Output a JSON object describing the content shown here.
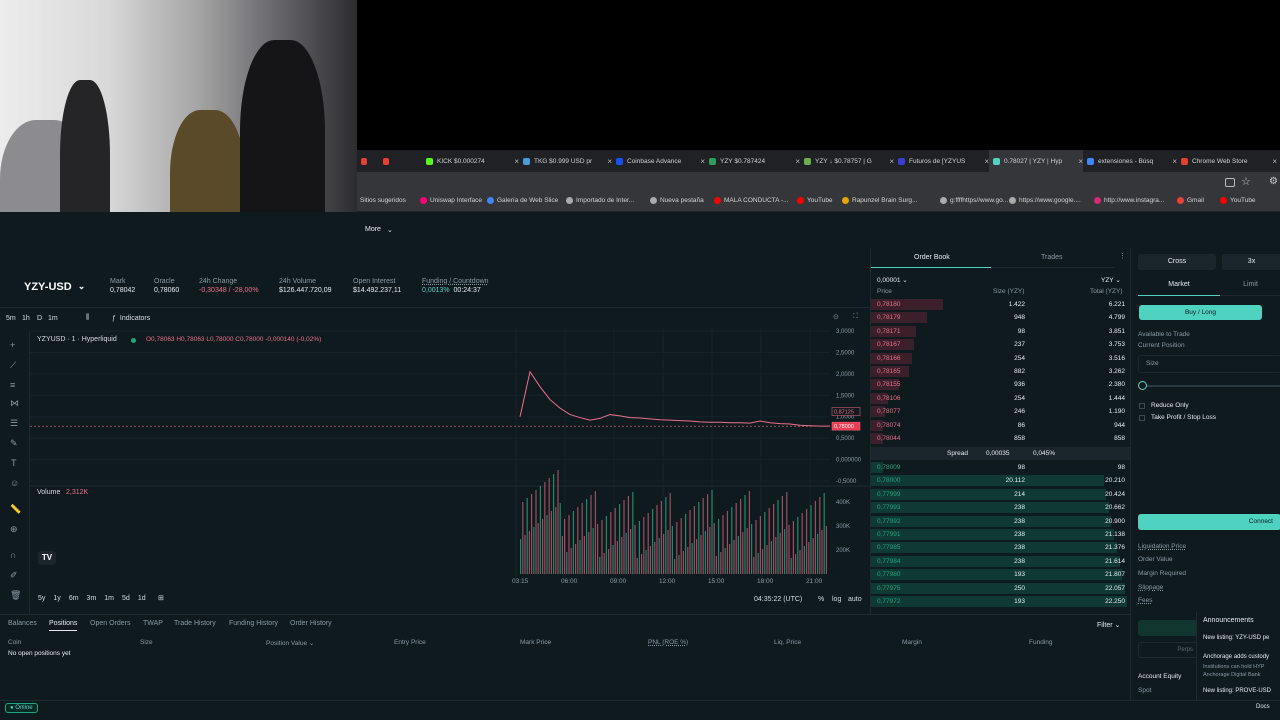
{
  "browser": {
    "tabs": [
      {
        "label": "KICK $0.000274",
        "color": "#53fc18"
      },
      {
        "label": "TKG $0.999 USD pr",
        "color": "#4a9bd6"
      },
      {
        "label": "Coinbase Advance",
        "color": "#1652f0"
      },
      {
        "label": "YZY $0.787424",
        "color": "#2b9e5a"
      },
      {
        "label": "YZY ↓ $0.78757 | G",
        "color": "#6ab04c"
      },
      {
        "label": "Futuros de [YZYUS",
        "color": "#3b3bd6"
      },
      {
        "label": "0.78027 | YZY | Hyp",
        "color": "#50d2c1"
      },
      {
        "label": "extensiones - Búsq",
        "color": "#4285f4"
      },
      {
        "label": "Chrome Web Store",
        "color": "#e34133"
      }
    ],
    "bookmarks": [
      "Sitios sugeridos",
      "Uniswap Interface",
      "Galería de Web Slice",
      "Importado de Inter...",
      "Nueva pestaña",
      "MALA CONDUCTA -...",
      "YouTube",
      "Rapunzel Brain Surg...",
      "g:ffffhttps//www.go...",
      "https://www.google....",
      "http://www.instagra...",
      "Gmail",
      "YouTube"
    ]
  },
  "nav": {
    "more_label": "More"
  },
  "market": {
    "symbol": "YZY-USD",
    "stats": [
      {
        "label": "Mark",
        "value": "0,78042"
      },
      {
        "label": "Oracle",
        "value": "0,78060"
      },
      {
        "label": "24h Change",
        "value": "-0,30348 / -28,00%"
      },
      {
        "label": "24h Volume",
        "value": "$126.447.720,09"
      },
      {
        "label": "Open Interest",
        "value": "$14.492.237,11"
      },
      {
        "label": "Funding / Countdown",
        "value": "0,0013%",
        "value2": "00:24:37"
      }
    ]
  },
  "chart_toolbar": {
    "interval": "5m",
    "items": [
      "1h",
      "D",
      "1m"
    ],
    "indicators": "Indicators"
  },
  "chart_legend": {
    "title": "YZYUSD · 1 · Hyperliquid",
    "ohlc": "O0,78063 H0,78063 L0,78000 C0,78000 -0,000140 (-0,02%)",
    "volume_label": "Volume",
    "volume_value": "2,312K"
  },
  "chart_data": {
    "type": "line",
    "x_ticks": [
      "03:15",
      "06:00",
      "09:00",
      "12:00",
      "15:00",
      "18:00",
      "21:00"
    ],
    "y_ticks": [
      "3,0000",
      "2,5000",
      "2,0000",
      "1,5000",
      "1,0000",
      "0,5000",
      "0,000000",
      "-0,5000"
    ],
    "price_labels": [
      "0,87125",
      "0,78000"
    ],
    "volume_ticks": [
      "400K",
      "300K",
      "200K"
    ],
    "series": [
      {
        "values": [
          1.0,
          2.05,
          1.7,
          1.4,
          1.2,
          1.05,
          0.98,
          0.92,
          0.96,
          1.05,
          1.02,
          0.98,
          0.97,
          0.95,
          0.93,
          0.92,
          0.91,
          0.9,
          0.88,
          0.87,
          0.87,
          0.86,
          0.86,
          0.85,
          0.9,
          0.86,
          0.84,
          0.83,
          0.8,
          0.79,
          0.78,
          0.78
        ]
      }
    ]
  },
  "chart_bottom": {
    "ranges": [
      "5y",
      "1y",
      "6m",
      "3m",
      "1m",
      "5d",
      "1d"
    ],
    "time": "04:35:22 (UTC)",
    "pct": "%",
    "log": "log",
    "auto": "auto"
  },
  "orderbook": {
    "tab_book": "Order Book",
    "tab_trades": "Trades",
    "tick": "0,00001",
    "unit": "YZY",
    "headers": [
      "Price",
      "Size (YZY)",
      "Total (YZY)"
    ],
    "asks": [
      [
        "0,78180",
        "1.422",
        "6.221"
      ],
      [
        "0,78179",
        "948",
        "4.799"
      ],
      [
        "0,78171",
        "98",
        "3.851"
      ],
      [
        "0,78167",
        "237",
        "3.753"
      ],
      [
        "0,78166",
        "254",
        "3.516"
      ],
      [
        "0,78165",
        "882",
        "3.262"
      ],
      [
        "0,78155",
        "936",
        "2.380"
      ],
      [
        "0,78106",
        "254",
        "1.444"
      ],
      [
        "0,78077",
        "246",
        "1.190"
      ],
      [
        "0,78074",
        "86",
        "944"
      ],
      [
        "0,78044",
        "858",
        "858"
      ]
    ],
    "spread_label": "Spread",
    "spread_value": "0,00035",
    "spread_pct": "0,045%",
    "bids": [
      [
        "0,78009",
        "98",
        "98"
      ],
      [
        "0,78000",
        "20.112",
        "20.210"
      ],
      [
        "0,77999",
        "214",
        "20.424"
      ],
      [
        "0,77993",
        "238",
        "20.662"
      ],
      [
        "0,77992",
        "238",
        "20.900"
      ],
      [
        "0,77991",
        "238",
        "21.138"
      ],
      [
        "0,77985",
        "238",
        "21.376"
      ],
      [
        "0,77984",
        "238",
        "21.614"
      ],
      [
        "0,77980",
        "193",
        "21.807"
      ],
      [
        "0,77975",
        "250",
        "22.057"
      ],
      [
        "0,77972",
        "193",
        "22.250"
      ]
    ]
  },
  "trade_panel": {
    "margin_mode": "Cross",
    "leverage": "3x",
    "tab_market": "Market",
    "tab_limit": "Limit",
    "side": "Buy / Long",
    "available": "Available to Trade",
    "current_position": "Current Position",
    "size": "Size",
    "reduce_only": "Reduce Only",
    "tpsl": "Take Profit / Stop Loss",
    "connect": "Connect",
    "details": [
      "Liquidation Price",
      "Order Value",
      "Margin Required",
      "Slippage",
      "Fees"
    ],
    "perps": "Perps",
    "account_equity": "Account Equity",
    "spot": "Spot"
  },
  "announcements": {
    "title": "Announcements",
    "items": [
      "New listing: YZY-USD pe",
      "Anchorage adds custody",
      "Institutions can hold HYP",
      "Anchorage Digital Bank",
      "New listing: PROVE-USD"
    ],
    "docs": "Docs"
  },
  "positions": {
    "tabs": [
      "Balances",
      "Positions",
      "Open Orders",
      "TWAP",
      "Trade History",
      "Funding History",
      "Order History"
    ],
    "filter": "Filter",
    "columns": [
      "Coin",
      "Size",
      "Position Value",
      "Entry Price",
      "Mark Price",
      "PNL (ROE %)",
      "Liq. Price",
      "Margin",
      "Funding"
    ],
    "empty": "No open positions yet"
  },
  "footer": {
    "status": "Online"
  },
  "colors": {
    "accent": "#50d2c1",
    "ask": "#ed7088",
    "bid": "#1fa67d",
    "bg": "#0f1a1f"
  }
}
